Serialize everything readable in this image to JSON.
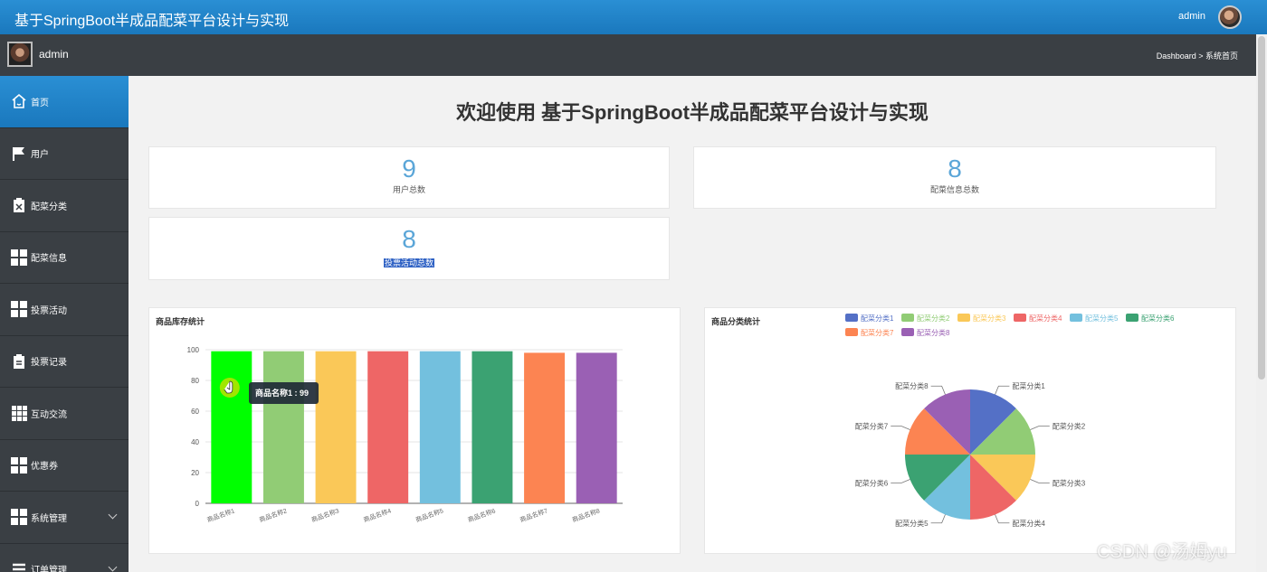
{
  "app": {
    "title": "基于SpringBoot半成品配菜平台设计与实现",
    "user": "admin",
    "icons": {
      "avatar": "user-avatar-icon"
    }
  },
  "subbar": {
    "username": "admin",
    "breadcrumb": "Dashboard > 系统首页"
  },
  "sidebar": {
    "items": [
      {
        "label": "首页",
        "icon": "home-icon",
        "active": true
      },
      {
        "label": "用户",
        "icon": "flag-icon"
      },
      {
        "label": "配菜分类",
        "icon": "clipboard-x-icon"
      },
      {
        "label": "配菜信息",
        "icon": "grid-icon"
      },
      {
        "label": "投票活动",
        "icon": "grid-icon"
      },
      {
        "label": "投票记录",
        "icon": "clipboard-icon"
      },
      {
        "label": "互动交流",
        "icon": "grid9-icon"
      },
      {
        "label": "优惠券",
        "icon": "grid-icon"
      },
      {
        "label": "系统管理",
        "icon": "grid-icon",
        "expandable": true
      },
      {
        "label": "订单管理",
        "icon": "list-icon",
        "expandable": true
      }
    ]
  },
  "main": {
    "welcome": "欢迎使用 基于SpringBoot半成品配菜平台设计与实现",
    "stats": [
      {
        "value": "9",
        "label": "用户总数"
      },
      {
        "value": "8",
        "label": "配菜信息总数"
      },
      {
        "value": "8",
        "label": "投票活动总数"
      }
    ]
  },
  "watermark": "CSDN @汤姆yu",
  "colors": {
    "primary": "#1a78bd",
    "sidebar_bg": "#3a3f44",
    "stat_number": "#5ba6d8"
  },
  "chart_data": [
    {
      "type": "bar",
      "title": "商品库存统计",
      "categories": [
        "商品名称1",
        "商品名称2",
        "商品名称3",
        "商品名称4",
        "商品名称5",
        "商品名称6",
        "商品名称7",
        "商品名称8"
      ],
      "values": [
        99,
        99,
        99,
        99,
        99,
        99,
        98,
        98
      ],
      "ylim": [
        0,
        100
      ],
      "yticks": [
        0,
        20,
        40,
        60,
        80,
        100
      ],
      "colors": [
        "#00ff00",
        "#91cc75",
        "#fac858",
        "#ee6666",
        "#73c0de",
        "#3ba272",
        "#fc8452",
        "#9a60b4"
      ],
      "tooltip": "商品名称1 : 99",
      "grid": true
    },
    {
      "type": "pie",
      "title": "商品分类统计",
      "labels": [
        "配菜分类1",
        "配菜分类2",
        "配菜分类3",
        "配菜分类4",
        "配菜分类5",
        "配菜分类6",
        "配菜分类7",
        "配菜分类8"
      ],
      "values": [
        1,
        1,
        1,
        1,
        1,
        1,
        1,
        1
      ],
      "colors": [
        "#5470c6",
        "#91cc75",
        "#fac858",
        "#ee6666",
        "#73c0de",
        "#3ba272",
        "#fc8452",
        "#9a60b4"
      ],
      "legend": "top-right"
    }
  ]
}
